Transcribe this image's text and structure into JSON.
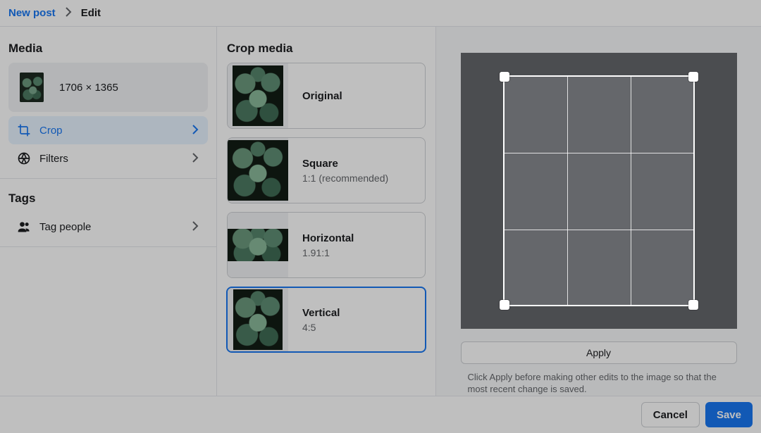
{
  "breadcrumb": {
    "parent": "New post",
    "current": "Edit"
  },
  "left": {
    "media_title": "Media",
    "image_dimensions": "1706 × 1365",
    "crop_label": "Crop",
    "filters_label": "Filters",
    "tags_title": "Tags",
    "tag_people_label": "Tag people"
  },
  "crop": {
    "title": "Crop media",
    "options": [
      {
        "name": "Original",
        "sub": ""
      },
      {
        "name": "Square",
        "sub": "1:1 (recommended)"
      },
      {
        "name": "Horizontal",
        "sub": "1.91:1"
      },
      {
        "name": "Vertical",
        "sub": "4:5"
      }
    ]
  },
  "right": {
    "apply_label": "Apply",
    "hint": "Click Apply before making other edits to the image so that the most recent change is saved."
  },
  "footer": {
    "cancel": "Cancel",
    "save": "Save"
  }
}
